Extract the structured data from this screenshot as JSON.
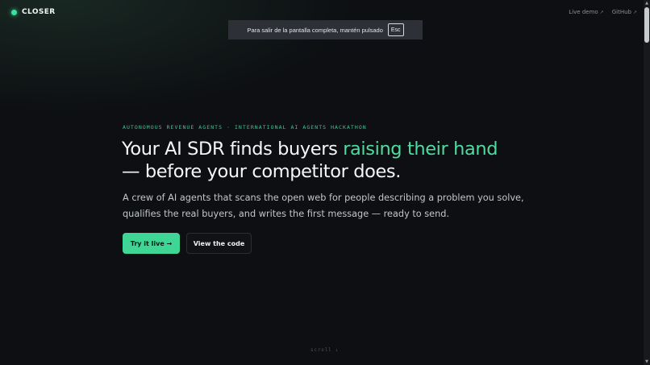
{
  "header": {
    "brand": "CLOSER",
    "links": [
      {
        "label": "Live demo",
        "arrow": "↗"
      },
      {
        "label": "GitHub",
        "arrow": "↗"
      }
    ]
  },
  "fullscreen_toast": {
    "message": "Para salir de la pantalla completa, mantén pulsado",
    "key": "Esc"
  },
  "hero": {
    "eyebrow": "AUTONOMOUS REVENUE AGENTS · INTERNATIONAL AI AGENTS HACKATHON",
    "headline_part1": "Your AI SDR finds buyers ",
    "headline_accent": "raising their hand",
    "headline_part2": "— before your competitor does.",
    "subhead": "A crew of AI agents that scans the open web for people describing a problem you solve, qualifies the real buyers, and writes the first message — ready to send.",
    "primary_cta": "Try it live →",
    "secondary_cta": "View the code",
    "scroll_hint": "scroll ↓"
  },
  "scrollbar": {
    "up": "▲",
    "down": "▼"
  },
  "colors": {
    "accent": "#4fdca0",
    "background": "#0d0f12",
    "button_primary": "#3fd594"
  }
}
